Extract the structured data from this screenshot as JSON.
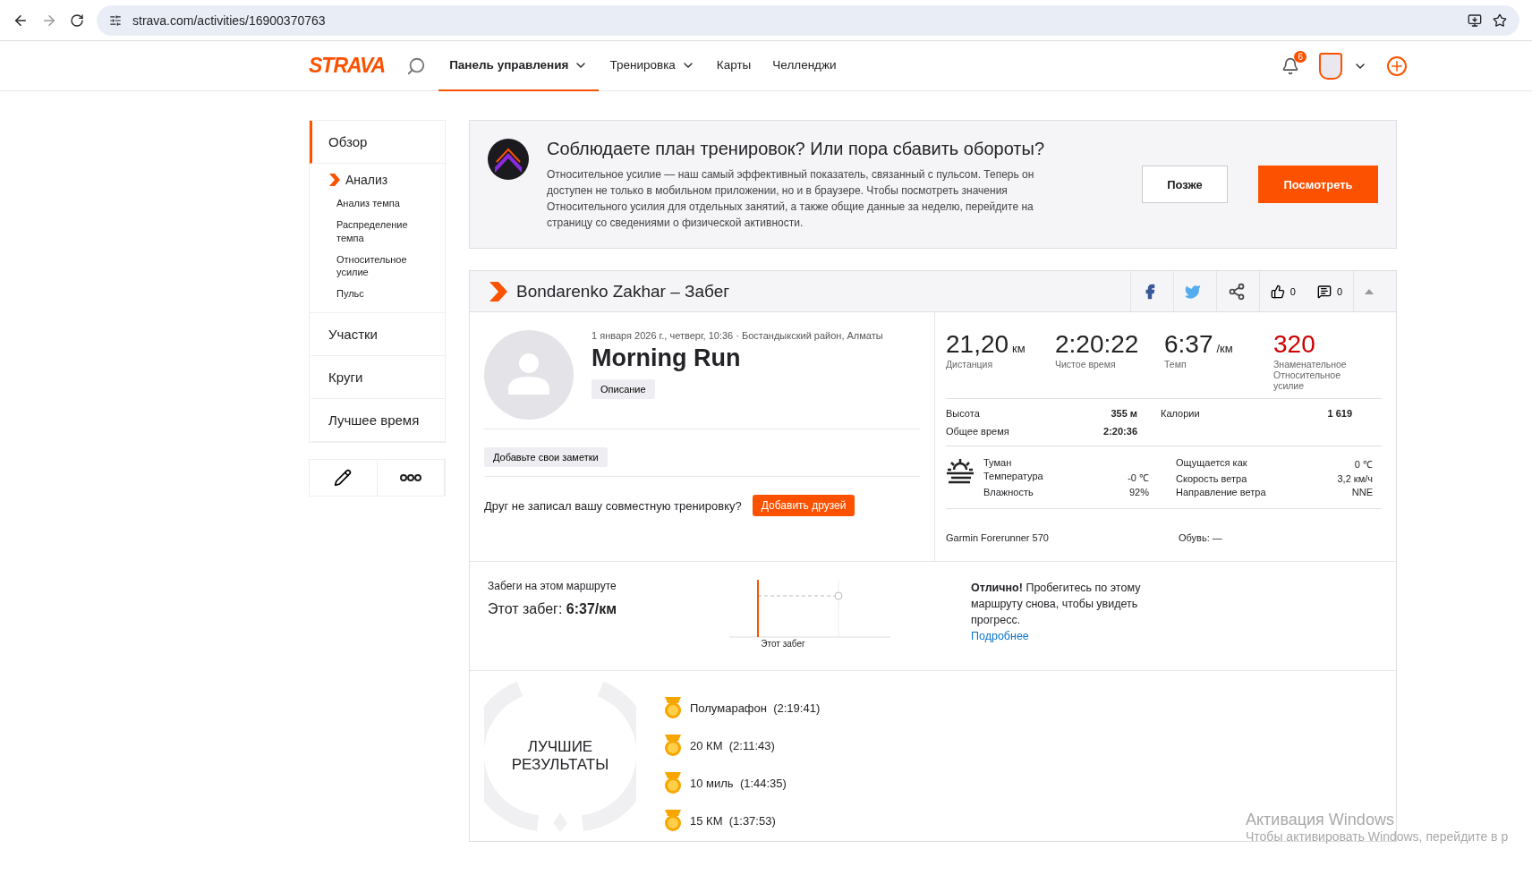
{
  "browser": {
    "url": "strava.com/activities/16900370763"
  },
  "nav": {
    "logo": "STRAVA",
    "items": [
      {
        "label": "Панель управления",
        "selected": true,
        "dropdown": true
      },
      {
        "label": "Тренировка",
        "selected": false,
        "dropdown": true
      },
      {
        "label": "Карты",
        "selected": false,
        "dropdown": false
      },
      {
        "label": "Челленджи",
        "selected": false,
        "dropdown": false
      }
    ],
    "notifications": "6"
  },
  "sidebar": {
    "items": [
      {
        "label": "Обзор",
        "selected": true,
        "kind": "main"
      },
      {
        "label": "Анализ",
        "selected": false,
        "kind": "group",
        "children": [
          {
            "label": "Анализ темпа"
          },
          {
            "label": "Распределение темпа"
          },
          {
            "label": "Относительное усилие"
          },
          {
            "label": "Пульс"
          }
        ]
      },
      {
        "label": "Участки",
        "selected": false,
        "kind": "main"
      },
      {
        "label": "Круги",
        "selected": false,
        "kind": "main"
      },
      {
        "label": "Лучшее время",
        "selected": false,
        "kind": "main"
      }
    ]
  },
  "banner": {
    "title": "Соблюдаете план тренировок? Или пора сбавить обороты?",
    "text": "Относительное усилие — наш самый эффективный показатель, связанный с пульсом. Теперь он доступен не только в мобильном приложении, но и в браузере. Чтобы посмотреть значения Относительного усилия для отдельных занятий, а также общие данные за неделю, перейдите на страницу со сведениями о физической активности.",
    "buttons": [
      {
        "label": "Позже",
        "kind": "secondary"
      },
      {
        "label": "Посмотреть",
        "kind": "primary"
      }
    ]
  },
  "activity": {
    "title": "Bondarenko Zakhar – Забег",
    "likes": "0",
    "comments": "0",
    "meta": "1 января 2026 г., четверг, 10:36 · Бостандыкский район, Алматы",
    "name": "Morning Run",
    "description_button": "Описание",
    "notes_button": "Добавьте свои заметки",
    "friend_prompt": "Друг не записал вашу совместную тренировку?",
    "friend_button": "Добавить друзей",
    "stats": [
      {
        "value": "21,20",
        "unit": "км",
        "label": "Дистанция",
        "highlight": false
      },
      {
        "value": "2:20:22",
        "label": "Чистое время",
        "highlight": false
      },
      {
        "value": "6:37",
        "unit": "/км",
        "label": "Темп",
        "highlight": false
      },
      {
        "value": "320",
        "label": "Знаменательное Относительное усилие",
        "highlight": true
      }
    ],
    "details": [
      {
        "label": "Высота",
        "value": "355 м"
      },
      {
        "label": "Калории",
        "value": "1 619"
      },
      {
        "label": "Общее время",
        "value": "2:20:36"
      }
    ],
    "weather": {
      "condition": "Туман",
      "rows": [
        {
          "label": "Температура",
          "value": "-0 ℃"
        },
        {
          "label": "Влажность",
          "value": "92%"
        }
      ],
      "side_rows": [
        {
          "label": "Ощущается как",
          "value": "0 ℃"
        },
        {
          "label": "Скорость ветра",
          "value": "3,2 км/ч"
        },
        {
          "label": "Направление ветра",
          "value": "NNE"
        }
      ]
    },
    "device": "Garmin Forerunner 570",
    "shoes": "Обувь: —"
  },
  "route": {
    "heading": "Забеги на этом маршруте",
    "this_run_label": "Этот забег: ",
    "this_run_value": "6:37/км",
    "chart_label": "Этот забег",
    "message": "**Отлично!** Пробегитесь по этому маршруту снова, чтобы увидеть прогресс.",
    "link": "Подробнее"
  },
  "best": {
    "title": "ЛУЧШИЕ РЕЗУЛЬТАТЫ",
    "items": [
      {
        "name": "Полумарафон",
        "time": "(2:19:41)"
      },
      {
        "name": "20 КМ",
        "time": "(2:11:43)"
      },
      {
        "name": "10 миль",
        "time": "(1:44:35)"
      },
      {
        "name": "15 КМ",
        "time": "(1:37:53)"
      }
    ]
  },
  "os_watermark": {
    "title": "Активация Windows",
    "text": "Чтобы активировать Windows, перейдите в р"
  }
}
